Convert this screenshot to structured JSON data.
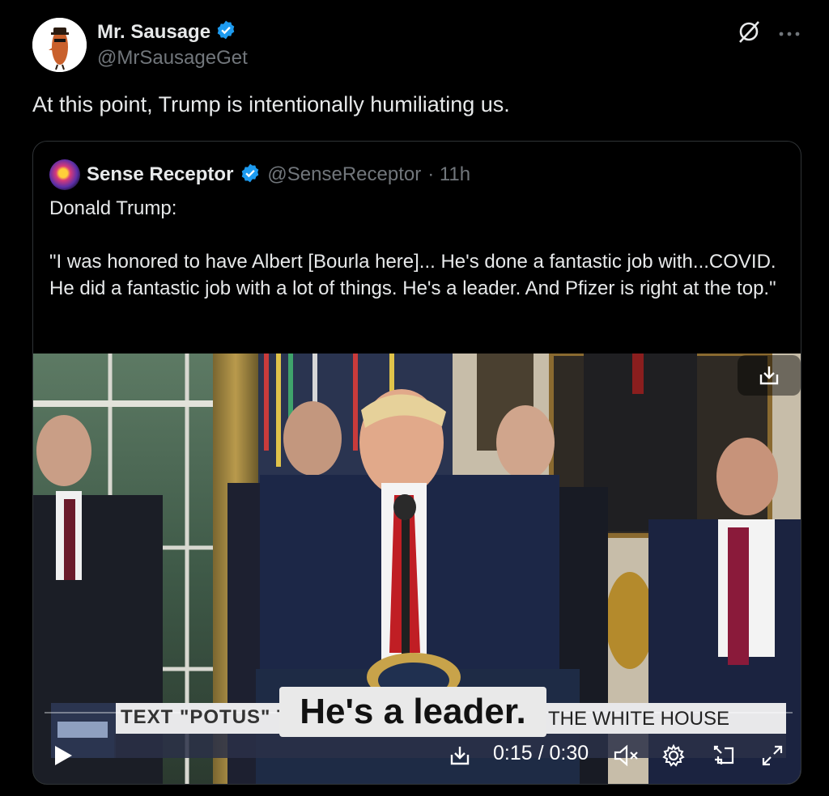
{
  "author": {
    "name": "Mr. Sausage",
    "handle": "@MrSausageGet",
    "verified": true
  },
  "tweet": {
    "text": "At this point, Trump is intentionally humiliating us."
  },
  "quoted": {
    "name": "Sense Receptor",
    "handle": "@SenseReceptor",
    "time": "· 11h",
    "verified": true,
    "body": "Donald Trump:\n\n\"I was honored to have Albert [Bourla here]... He's done a fantastic job with...COVID. He did a fantastic job with a lot of things. He's a leader. And Pfizer is right at the top.\""
  },
  "video": {
    "caption": "He's a leader.",
    "banner_left": "TEXT \"POTUS\" T",
    "banner_right": "THE WHITE HOUSE",
    "time_current": "0:15",
    "time_sep": " / ",
    "time_total": "0:30",
    "progress": 0.5
  },
  "icons": {
    "verified": "verified-badge-icon",
    "grok": "grok-icon",
    "more": "more-icon",
    "download": "download-icon",
    "play": "play-icon",
    "mute": "mute-icon",
    "settings": "settings-icon",
    "pip": "pip-icon",
    "fullscreen": "fullscreen-icon"
  },
  "colors": {
    "background": "#000000",
    "text": "#e7e9ea",
    "muted": "#71767b",
    "verified": "#1d9bf0",
    "border": "#2f3336"
  }
}
